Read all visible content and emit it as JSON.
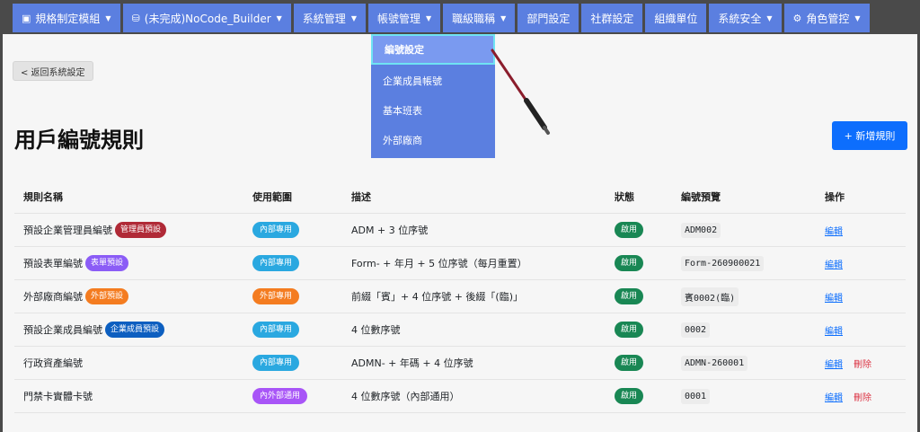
{
  "nav": {
    "items": [
      {
        "label": "規格制定模組",
        "icon": "document-icon"
      },
      {
        "label": "(未完成)NoCode_Builder",
        "icon": "database-icon"
      },
      {
        "label": "系統管理"
      },
      {
        "label": "帳號管理"
      },
      {
        "label": "職級職稱"
      },
      {
        "label": "部門設定"
      },
      {
        "label": "社群設定"
      },
      {
        "label": "組織單位"
      },
      {
        "label": "系統安全"
      },
      {
        "label": "角色管控",
        "icon": "user-gear-icon"
      }
    ]
  },
  "dropdown": {
    "items": [
      "編號設定",
      "企業成員帳號",
      "基本班表",
      "外部廠商"
    ]
  },
  "back_label": "< 返回系統設定",
  "page_title": "用戶編號規則",
  "add_label": "+ 新增規則",
  "table": {
    "headers": [
      "規則名稱",
      "使用範圍",
      "描述",
      "狀態",
      "編號預覽",
      "操作"
    ],
    "rows": [
      {
        "name": "預設企業管理員編號",
        "tag": "管理員預設",
        "tag_color": "#b02a37",
        "scope": "內部專用",
        "scope_color": "#2aa8e0",
        "desc": "ADM + 3 位序號",
        "status": "啟用",
        "preview": "ADM002",
        "edit": "編輯",
        "delete": ""
      },
      {
        "name": "預設表單編號",
        "tag": "表單預設",
        "tag_color": "#8b5cf6",
        "scope": "內部專用",
        "scope_color": "#2aa8e0",
        "desc": "Form- + 年月 + 5 位序號（每月重置）",
        "status": "啟用",
        "preview": "Form-260900021",
        "edit": "編輯",
        "delete": ""
      },
      {
        "name": "外部廠商編號",
        "tag": "外部預設",
        "tag_color": "#f47c20",
        "scope": "外部專用",
        "scope_color": "#f47c20",
        "desc": "前綴「賓」+ 4 位序號 + 後綴「(臨)」",
        "status": "啟用",
        "preview": "賓0002(臨)",
        "edit": "編輯",
        "delete": ""
      },
      {
        "name": "預設企業成員編號",
        "tag": "企業成員預設",
        "tag_color": "#0d5fc0",
        "scope": "內部專用",
        "scope_color": "#2aa8e0",
        "desc": "4 位數序號",
        "status": "啟用",
        "preview": "0002",
        "edit": "編輯",
        "delete": ""
      },
      {
        "name": "行政資產編號",
        "tag": "",
        "tag_color": "",
        "scope": "內部專用",
        "scope_color": "#2aa8e0",
        "desc": "ADMN- + 年碼 + 4 位序號",
        "status": "啟用",
        "preview": "ADMN-260001",
        "edit": "編輯",
        "delete": "刪除"
      },
      {
        "name": "門禁卡實體卡號",
        "tag": "",
        "tag_color": "",
        "scope": "內外部通用",
        "scope_color": "#a855f7",
        "desc": "4 位數序號（內部通用）",
        "status": "啟用",
        "preview": "0001",
        "edit": "編輯",
        "delete": "刪除"
      }
    ]
  }
}
